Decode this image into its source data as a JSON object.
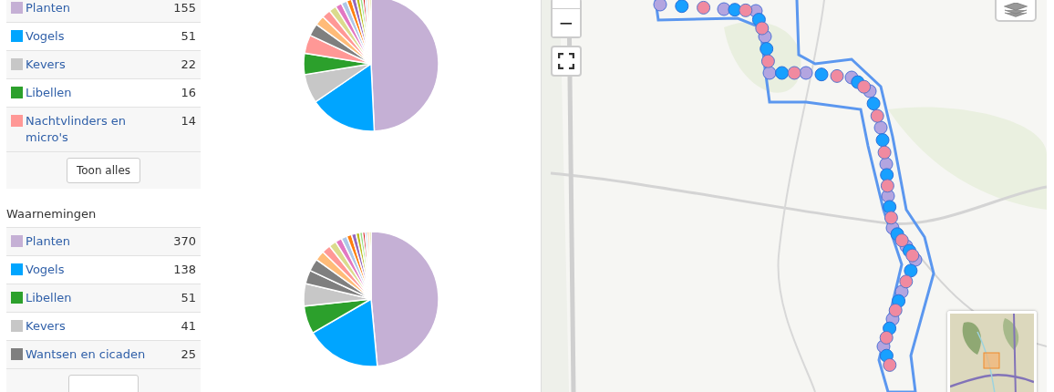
{
  "sections": [
    {
      "rows": [
        {
          "name": "Planten",
          "count": "155",
          "color": "#c5b0d5"
        },
        {
          "name": "Vogels",
          "count": "51",
          "color": "#00a5ff"
        },
        {
          "name": "Kevers",
          "count": "22",
          "color": "#c7c7c7"
        },
        {
          "name": "Libellen",
          "count": "16",
          "color": "#2ca02c"
        },
        {
          "name": "Nachtvlinders en micro's",
          "count": "14",
          "color": "#ff9896"
        }
      ],
      "button": "Toon alles"
    },
    {
      "title": "Waarnemingen",
      "rows": [
        {
          "name": "Planten",
          "count": "370",
          "color": "#c5b0d5"
        },
        {
          "name": "Vogels",
          "count": "138",
          "color": "#00a5ff"
        },
        {
          "name": "Libellen",
          "count": "51",
          "color": "#2ca02c"
        },
        {
          "name": "Kevers",
          "count": "41",
          "color": "#c7c7c7"
        },
        {
          "name": "Wantsen en cicaden",
          "count": "25",
          "color": "#7f7f7f"
        }
      ]
    }
  ],
  "map": {
    "kind": "picture",
    "zoom_out": "−"
  }
}
